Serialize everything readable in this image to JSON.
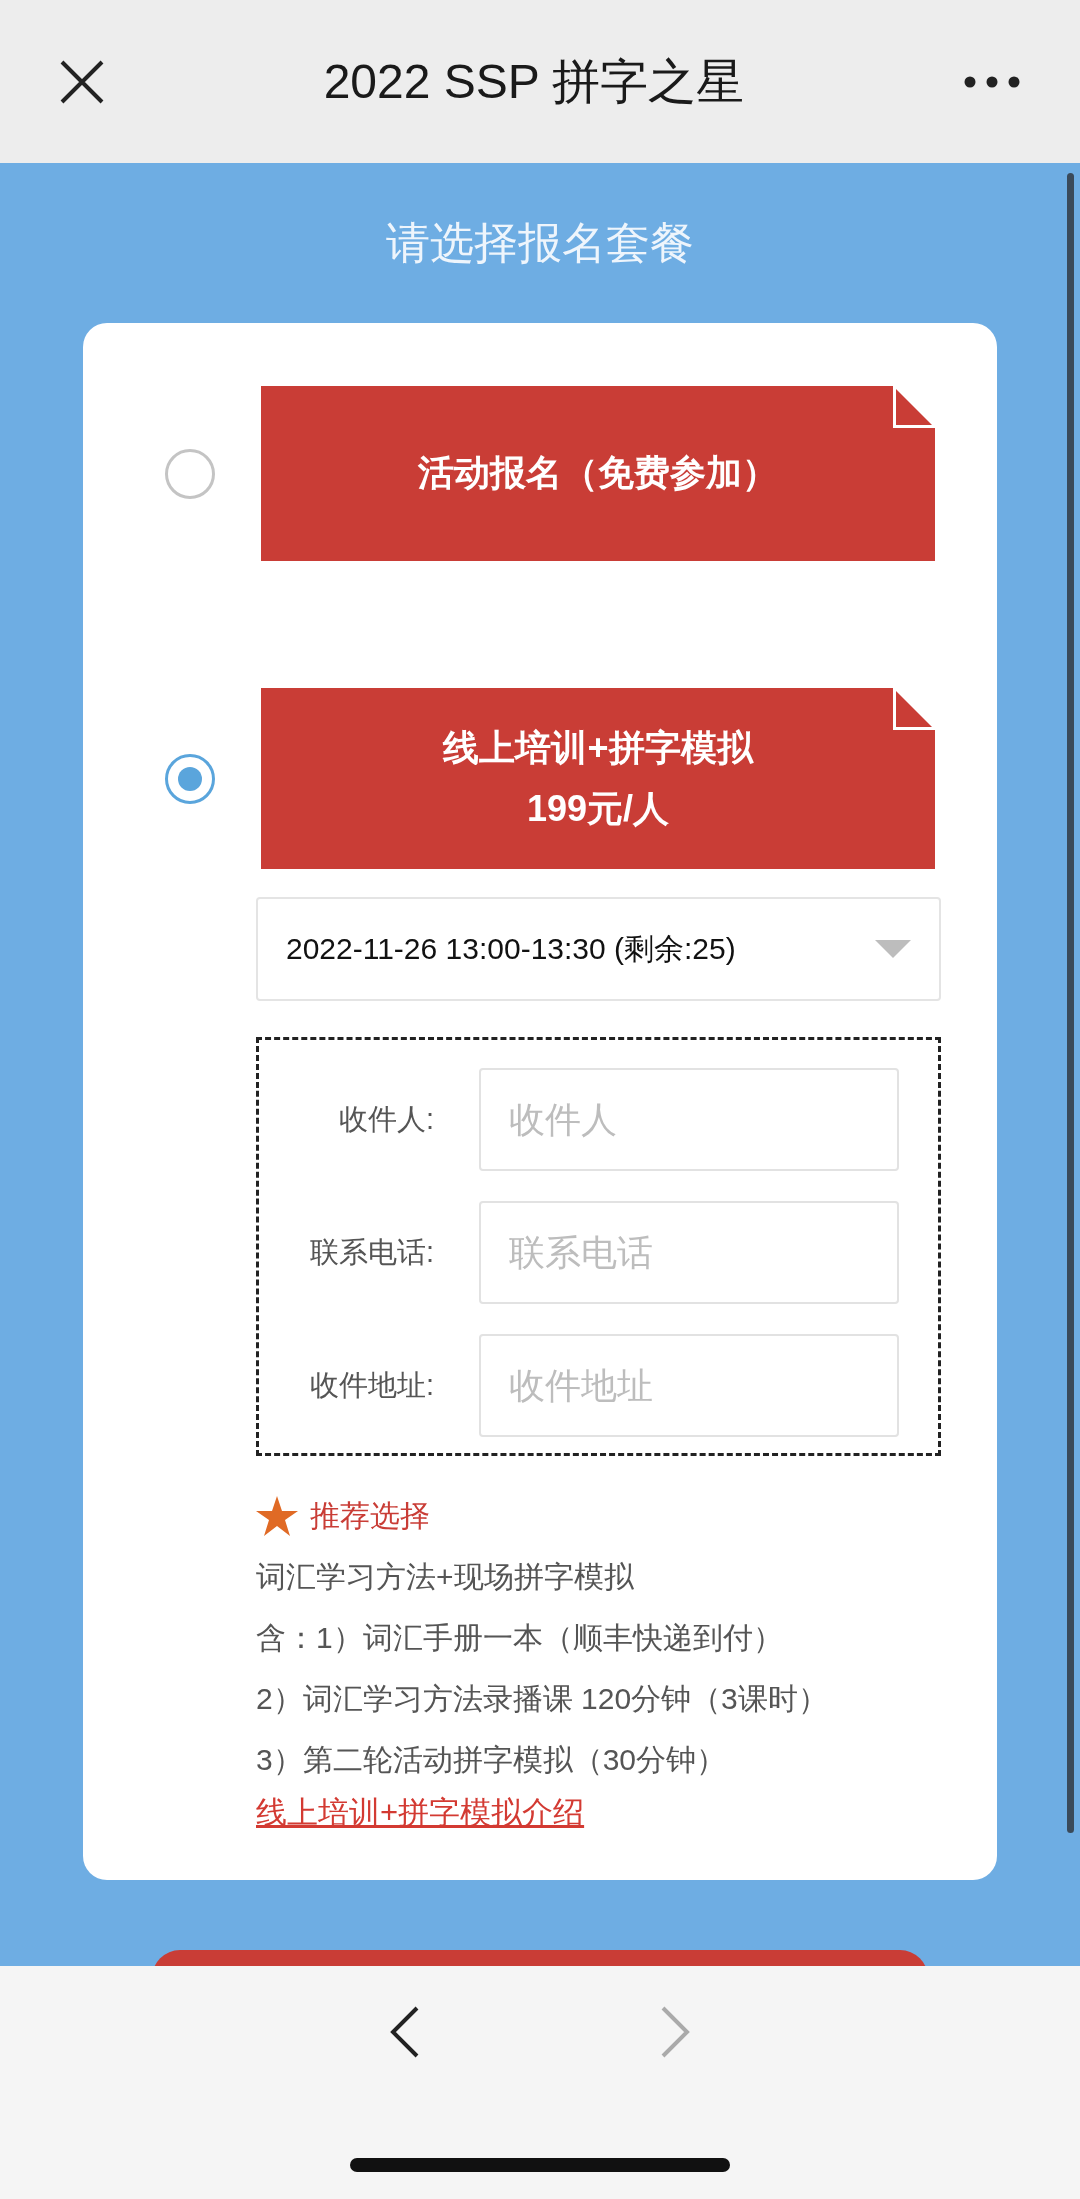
{
  "header": {
    "title": "2022 SSP 拼字之星"
  },
  "section_title": "请选择报名套餐",
  "options": [
    {
      "title": "活动报名（免费参加）",
      "selected": false
    },
    {
      "title": "线上培训+拼字模拟",
      "price": "199元/人",
      "selected": true
    }
  ],
  "time_select": {
    "value": "2022-11-26 13:00-13:30  (剩余:25)"
  },
  "fields": [
    {
      "label": "收件人:",
      "placeholder": "收件人"
    },
    {
      "label": "联系电话:",
      "placeholder": "联系电话"
    },
    {
      "label": "收件地址:",
      "placeholder": "收件地址"
    }
  ],
  "recommend": {
    "badge": "推荐选择",
    "lines": [
      "词汇学习方法+现场拼字模拟",
      "含：1）词汇手册一本（顺丰快递到付）",
      "2）词汇学习方法录播课 120分钟（3课时）",
      "3）第二轮活动拼字模拟（30分钟）"
    ],
    "link": "线上培训+拼字模拟介绍"
  },
  "nav": {
    "back_disabled": false,
    "forward_disabled": true
  }
}
